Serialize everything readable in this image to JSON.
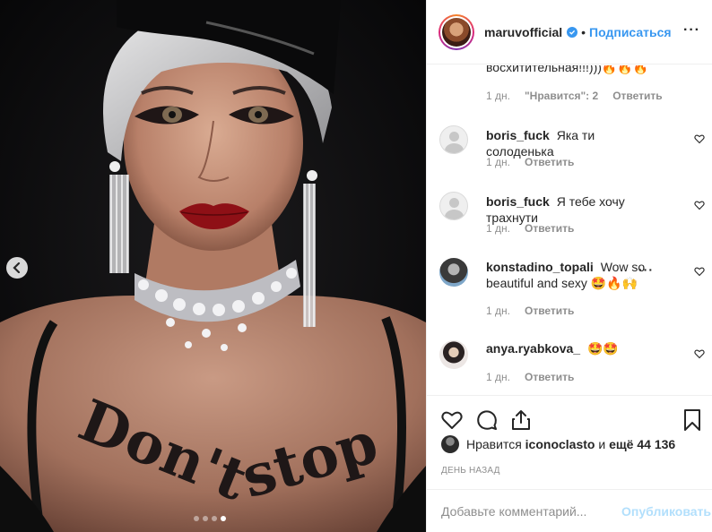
{
  "header": {
    "username": "maruvofficial",
    "separator": "•",
    "follow_label": "Подписаться",
    "more_label": "···"
  },
  "comments": {
    "partial": {
      "text": "восхитительная!!!)))🔥🔥🔥",
      "age": "1 дн.",
      "likes": "\"Нравится\": 2",
      "reply": "Ответить"
    },
    "items": [
      {
        "user": "boris_fuck",
        "text": "Яка ти солоденька",
        "age": "1 дн.",
        "reply": "Ответить"
      },
      {
        "user": "boris_fuck",
        "text": "Я тебе хочу трахнути",
        "age": "1 дн.",
        "reply": "Ответить"
      },
      {
        "user": "konstadino_topali",
        "text": "Wow so beautiful and sexy 🤩🔥🙌",
        "age": "1 дн.",
        "reply": "Ответить",
        "options": "···"
      },
      {
        "user": "anya.ryabkova_",
        "text": "🤩🤩",
        "age": "1 дн.",
        "reply": "Ответить"
      }
    ]
  },
  "likes": {
    "prefix": "Нравится",
    "user": "iconoclasto",
    "middle": "и",
    "rest": "ещё 44 136"
  },
  "time_ago": "ДЕНЬ НАЗАД",
  "comment_box": {
    "placeholder": "Добавьте комментарий...",
    "publish_label": "Опубликовать"
  },
  "carousel": {
    "count": 4,
    "active_index": 3
  },
  "photo": {
    "chest_text_line1": "Don't",
    "chest_text_line2": "stop"
  },
  "colors": {
    "accent": "#3897f0",
    "publish_disabled": "#b2dffc",
    "muted": "#8e8e8e",
    "border": "#efefef"
  }
}
